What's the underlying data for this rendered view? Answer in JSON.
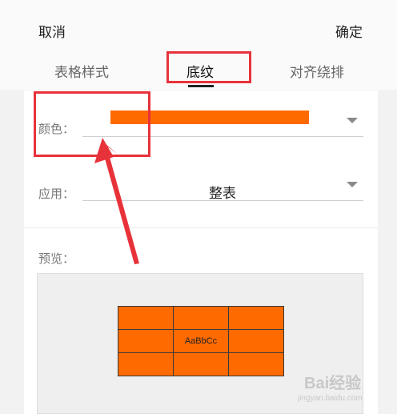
{
  "header": {
    "cancel_label": "取消",
    "confirm_label": "确定"
  },
  "tabs": [
    {
      "label": "表格样式"
    },
    {
      "label": "底纹"
    },
    {
      "label": "对齐绕排"
    }
  ],
  "active_tab": "底纹",
  "shading": {
    "color_label": "颜色：",
    "color_value": "#ff6a00",
    "apply_label": "应用：",
    "apply_value": "整表",
    "preview_label": "预览："
  },
  "preview": {
    "sample_text": "AaBbCc",
    "fill_color": "#ff6a00"
  },
  "annotation_color": "#e8323a",
  "watermark": {
    "brand": "Bai经验",
    "url": "jingyan.baidu.com"
  }
}
